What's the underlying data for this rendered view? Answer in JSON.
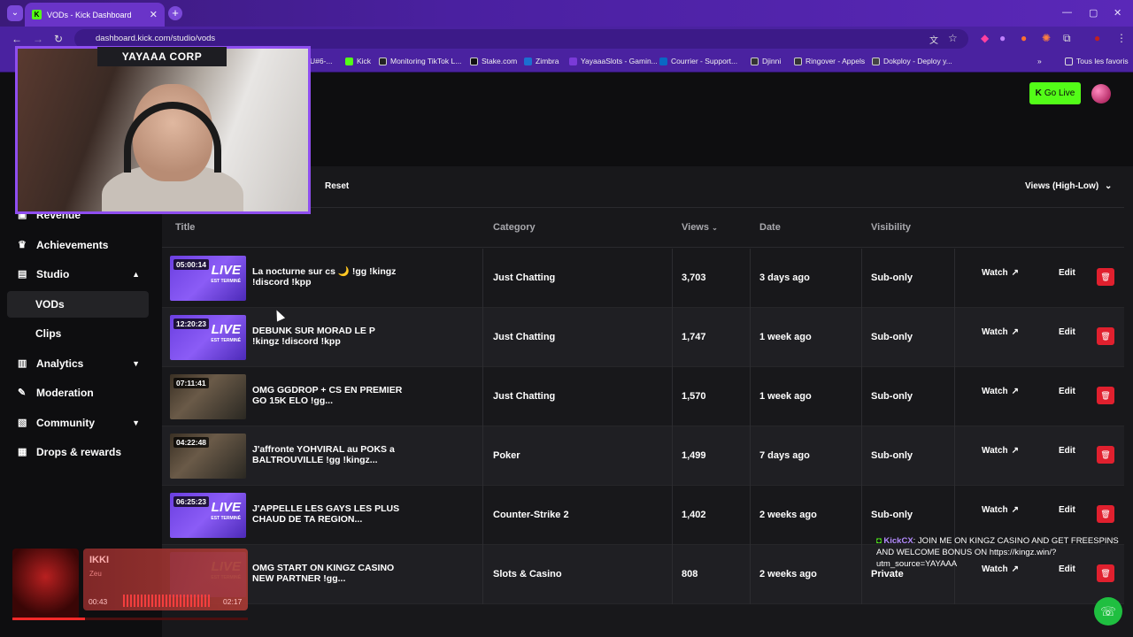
{
  "browser": {
    "tab_title": "VODs - Kick Dashboard",
    "tab_icon_letter": "K",
    "url": "dashboard.kick.com/studio/vods",
    "bookmarks": [
      {
        "label": "U#6-...",
        "color": "#444"
      },
      {
        "label": "Kick",
        "color": "#53fc18"
      },
      {
        "label": "Monitoring TikTok L...",
        "color": "#222"
      },
      {
        "label": "Stake.com",
        "color": "#111"
      },
      {
        "label": "Zimbra",
        "color": "#1c6fd0"
      },
      {
        "label": "YayaaaSlots - Gamin...",
        "color": "#7a3ad8"
      },
      {
        "label": "Courrier - Support...",
        "color": "#0a68c4"
      },
      {
        "label": "Djinni",
        "color": "#333"
      },
      {
        "label": "Ringover - Appels",
        "color": "#333"
      },
      {
        "label": "Dokploy - Deploy y...",
        "color": "#444"
      }
    ],
    "all_bookmarks_label": "Tous les favoris"
  },
  "header": {
    "go_live_label": "Go Live"
  },
  "overlay": {
    "cam_label": "YAYAAA CORP",
    "chat": {
      "username": "KickCX",
      "message": ": JOIN ME ON KINGZ CASINO AND GET FREESPINS AND WELCOME BONUS ON https://kingz.win/?utm_source=YAYAAA"
    },
    "music": {
      "song": "IKKI",
      "artist": "Zeu",
      "elapsed": "00:43",
      "total": "02:17",
      "progress": 0.31
    }
  },
  "sidebar": {
    "items": [
      {
        "label": "Revenue",
        "icon": "revenue-icon"
      },
      {
        "label": "Achievements",
        "icon": "trophy-icon"
      },
      {
        "label": "Studio",
        "icon": "studio-icon"
      },
      {
        "label": "VODs"
      },
      {
        "label": "Clips"
      },
      {
        "label": "Analytics",
        "icon": "analytics-icon"
      },
      {
        "label": "Moderation",
        "icon": "wrench-icon"
      },
      {
        "label": "Community",
        "icon": "community-icon"
      },
      {
        "label": "Drops & rewards",
        "icon": "gift-icon"
      }
    ]
  },
  "filters": {
    "reset_label": "Reset",
    "sort_label": "Views (High-Low)"
  },
  "table": {
    "headers": {
      "title": "Title",
      "category": "Category",
      "views": "Views",
      "date": "Date",
      "visibility": "Visibility"
    },
    "watch_label": "Watch",
    "edit_label": "Edit",
    "rows": [
      {
        "duration": "05:00:14",
        "title": "La nocturne sur cs 🌙 !gg !kingz !discord !kpp",
        "category": "Just Chatting",
        "views": "3,703",
        "date": "3 days ago",
        "visibility": "Sub-only",
        "thumb": "live"
      },
      {
        "duration": "12:20:23",
        "title": "DEBUNK SUR MORAD LE P !kingz !discord !kpp",
        "category": "Just Chatting",
        "views": "1,747",
        "date": "1 week ago",
        "visibility": "Sub-only",
        "thumb": "live"
      },
      {
        "duration": "07:11:41",
        "title": "OMG GGDROP + CS EN PREMIER GO 15K ELO !gg...",
        "category": "Just Chatting",
        "views": "1,570",
        "date": "1 week ago",
        "visibility": "Sub-only",
        "thumb": "cam"
      },
      {
        "duration": "04:22:48",
        "title": "J'affronte YOHVIRAL au POKS a BALTROUVILLE !gg !kingz...",
        "category": "Poker",
        "views": "1,499",
        "date": "7 days ago",
        "visibility": "Sub-only",
        "thumb": "cam"
      },
      {
        "duration": "06:25:23",
        "title": "J'APPELLE LES GAYS LES PLUS CHAUD DE TA REGION...",
        "category": "Counter-Strike 2",
        "views": "1,402",
        "date": "2 weeks ago",
        "visibility": "Sub-only",
        "thumb": "live"
      },
      {
        "duration": "",
        "title": "OMG START ON KINGZ CASINO NEW PARTNER !gg...",
        "category": "Slots & Casino",
        "views": "808",
        "date": "2 weeks ago",
        "visibility": "Private",
        "thumb": "live"
      }
    ],
    "thumb_live_text": "LIVE",
    "thumb_live_sub": "EST TERMINÉ"
  }
}
